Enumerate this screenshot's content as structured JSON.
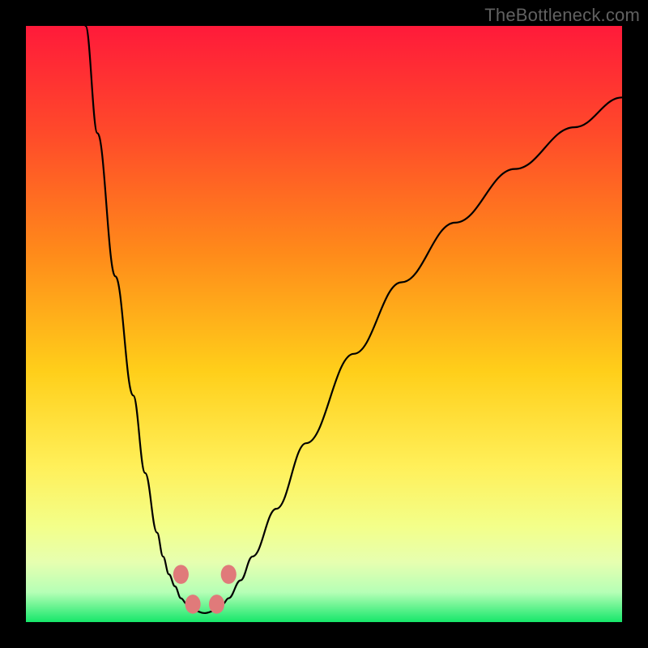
{
  "watermark": "TheBottleneck.com",
  "colors": {
    "frame_bg": "#000000",
    "watermark_text": "#616161",
    "curve_stroke": "#000000",
    "gradient_top": "#ff1a3a",
    "gradient_upper_mid": "#ff6a1f",
    "gradient_mid": "#ffd21a",
    "gradient_lower_mid": "#f6ff7a",
    "gradient_band": "#ecff9e",
    "gradient_bottom": "#16e76a",
    "marker_fill": "#e07a7a"
  },
  "chart_data": {
    "type": "line",
    "title": "",
    "xlabel": "",
    "ylabel": "",
    "xlim": [
      0,
      100
    ],
    "ylim": [
      0,
      100
    ],
    "axes_visible": false,
    "grid": false,
    "series": [
      {
        "name": "left-branch",
        "x": [
          10,
          12,
          15,
          18,
          20,
          22,
          23,
          24,
          25,
          26,
          27
        ],
        "values": [
          100,
          82,
          58,
          38,
          25,
          15,
          11,
          8,
          6,
          4,
          3
        ]
      },
      {
        "name": "right-branch",
        "x": [
          33,
          34,
          36,
          38,
          42,
          47,
          55,
          63,
          72,
          82,
          92,
          100
        ],
        "values": [
          3,
          4,
          7,
          11,
          19,
          30,
          45,
          57,
          67,
          76,
          83,
          88
        ]
      },
      {
        "name": "valley-floor",
        "x": [
          27,
          28,
          30,
          32,
          33
        ],
        "values": [
          3,
          2,
          1.5,
          2,
          3
        ]
      }
    ],
    "markers": [
      {
        "name": "left-upper-marker",
        "cx": 26,
        "cy": 8,
        "rx": 1.3,
        "ry": 1.6
      },
      {
        "name": "left-lower-marker",
        "cx": 28,
        "cy": 3,
        "rx": 1.3,
        "ry": 1.6
      },
      {
        "name": "right-lower-marker",
        "cx": 32,
        "cy": 3,
        "rx": 1.3,
        "ry": 1.6
      },
      {
        "name": "right-upper-marker",
        "cx": 34,
        "cy": 8,
        "rx": 1.3,
        "ry": 1.6
      }
    ],
    "background_gradient_stops": [
      {
        "offset": 0,
        "color": "#ff1a3a"
      },
      {
        "offset": 18,
        "color": "#ff4a2a"
      },
      {
        "offset": 38,
        "color": "#ff8a1a"
      },
      {
        "offset": 58,
        "color": "#ffcf1a"
      },
      {
        "offset": 74,
        "color": "#fff05a"
      },
      {
        "offset": 84,
        "color": "#f3ff8a"
      },
      {
        "offset": 90,
        "color": "#e6ffb0"
      },
      {
        "offset": 95,
        "color": "#b6ffb6"
      },
      {
        "offset": 100,
        "color": "#16e76a"
      }
    ]
  }
}
